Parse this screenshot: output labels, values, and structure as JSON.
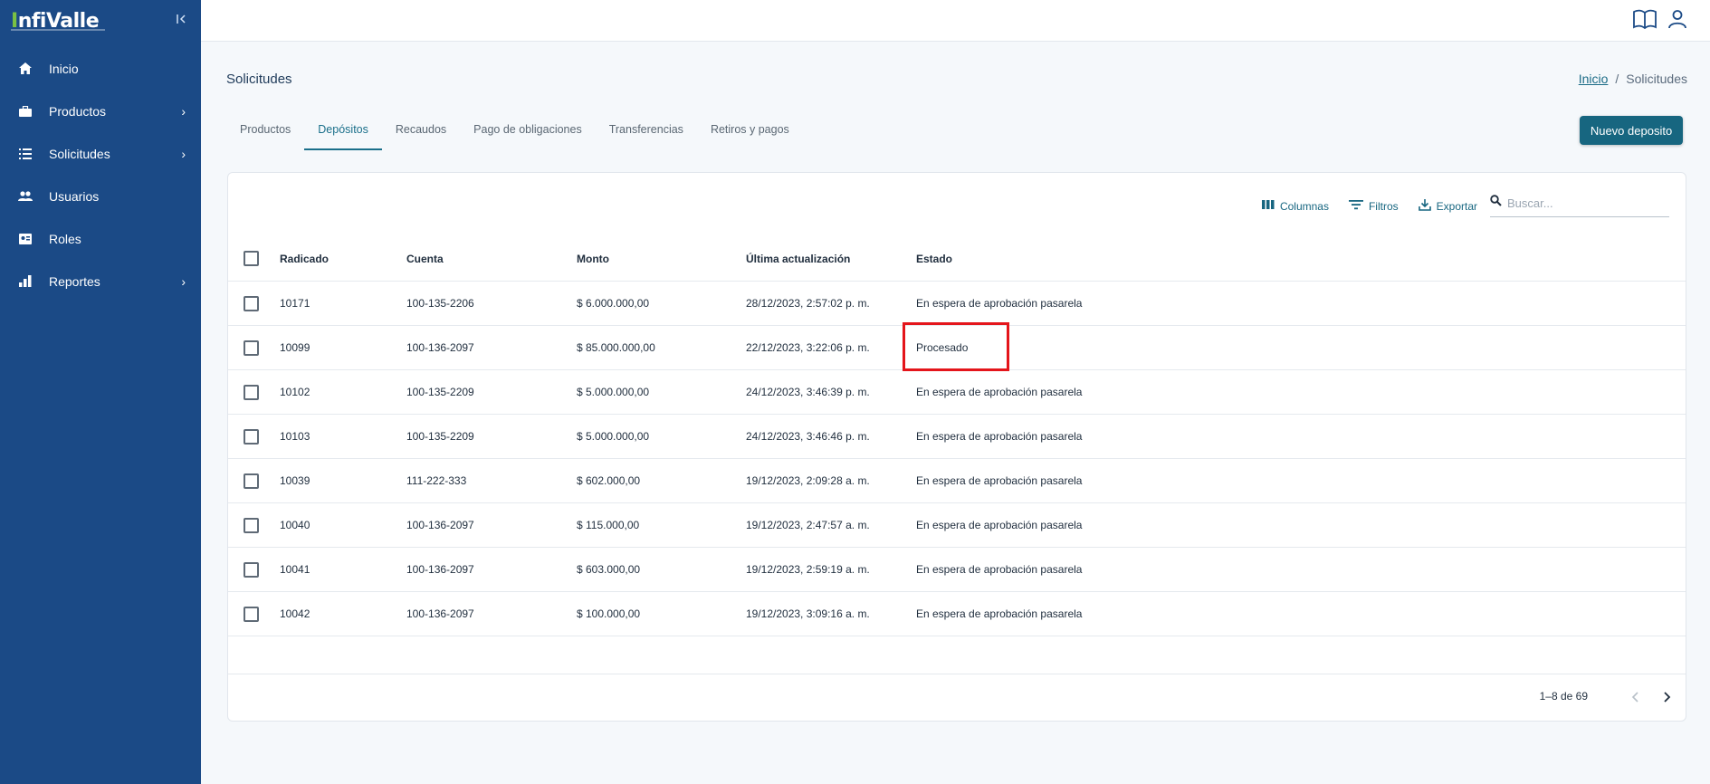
{
  "brand": {
    "name_prefix": "I",
    "name_rest": "nfiValle"
  },
  "sidebar": {
    "items": [
      {
        "label": "Inicio",
        "icon": "home-icon",
        "has_children": false
      },
      {
        "label": "Productos",
        "icon": "briefcase-icon",
        "has_children": true
      },
      {
        "label": "Solicitudes",
        "icon": "list-icon",
        "has_children": true
      },
      {
        "label": "Usuarios",
        "icon": "users-icon",
        "has_children": false
      },
      {
        "label": "Roles",
        "icon": "id-card-icon",
        "has_children": false
      },
      {
        "label": "Reportes",
        "icon": "bar-chart-icon",
        "has_children": true
      }
    ]
  },
  "header": {
    "icons": [
      "book-icon",
      "user-icon"
    ]
  },
  "page": {
    "title": "Solicitudes"
  },
  "breadcrumb": {
    "home": "Inicio",
    "separator": "/",
    "current": "Solicitudes"
  },
  "tabs": [
    {
      "label": "Productos",
      "active": false
    },
    {
      "label": "Depósitos",
      "active": true
    },
    {
      "label": "Recaudos",
      "active": false
    },
    {
      "label": "Pago de obligaciones",
      "active": false
    },
    {
      "label": "Transferencias",
      "active": false
    },
    {
      "label": "Retiros y pagos",
      "active": false
    }
  ],
  "actions": {
    "new_button": "Nuevo deposito"
  },
  "toolbar": {
    "columns": "Columnas",
    "filters": "Filtros",
    "export": "Exportar",
    "search_placeholder": "Buscar..."
  },
  "table": {
    "headers": [
      "Radicado",
      "Cuenta",
      "Monto",
      "Última actualización",
      "Estado"
    ],
    "rows": [
      [
        "10171",
        "100-135-2206",
        "$ 6.000.000,00",
        "28/12/2023, 2:57:02 p. m.",
        "En espera de aprobación pasarela"
      ],
      [
        "10099",
        "100-136-2097",
        "$ 85.000.000,00",
        "22/12/2023, 3:22:06 p. m.",
        "Procesado"
      ],
      [
        "10102",
        "100-135-2209",
        "$ 5.000.000,00",
        "24/12/2023, 3:46:39 p. m.",
        "En espera de aprobación pasarela"
      ],
      [
        "10103",
        "100-135-2209",
        "$ 5.000.000,00",
        "24/12/2023, 3:46:46 p. m.",
        "En espera de aprobación pasarela"
      ],
      [
        "10039",
        "111-222-333",
        "$ 602.000,00",
        "19/12/2023, 2:09:28 a. m.",
        "En espera de aprobación pasarela"
      ],
      [
        "10040",
        "100-136-2097",
        "$ 115.000,00",
        "19/12/2023, 2:47:57 a. m.",
        "En espera de aprobación pasarela"
      ],
      [
        "10041",
        "100-136-2097",
        "$ 603.000,00",
        "19/12/2023, 2:59:19 a. m.",
        "En espera de aprobación pasarela"
      ],
      [
        "10042",
        "100-136-2097",
        "$ 100.000,00",
        "19/12/2023, 3:09:16 a. m.",
        "En espera de aprobación pasarela"
      ]
    ]
  },
  "pagination": {
    "range_text": "1–8 de 69"
  },
  "colors": {
    "sidebar": "#1b4a86",
    "accent": "#176680",
    "highlight": "#e4151b"
  }
}
